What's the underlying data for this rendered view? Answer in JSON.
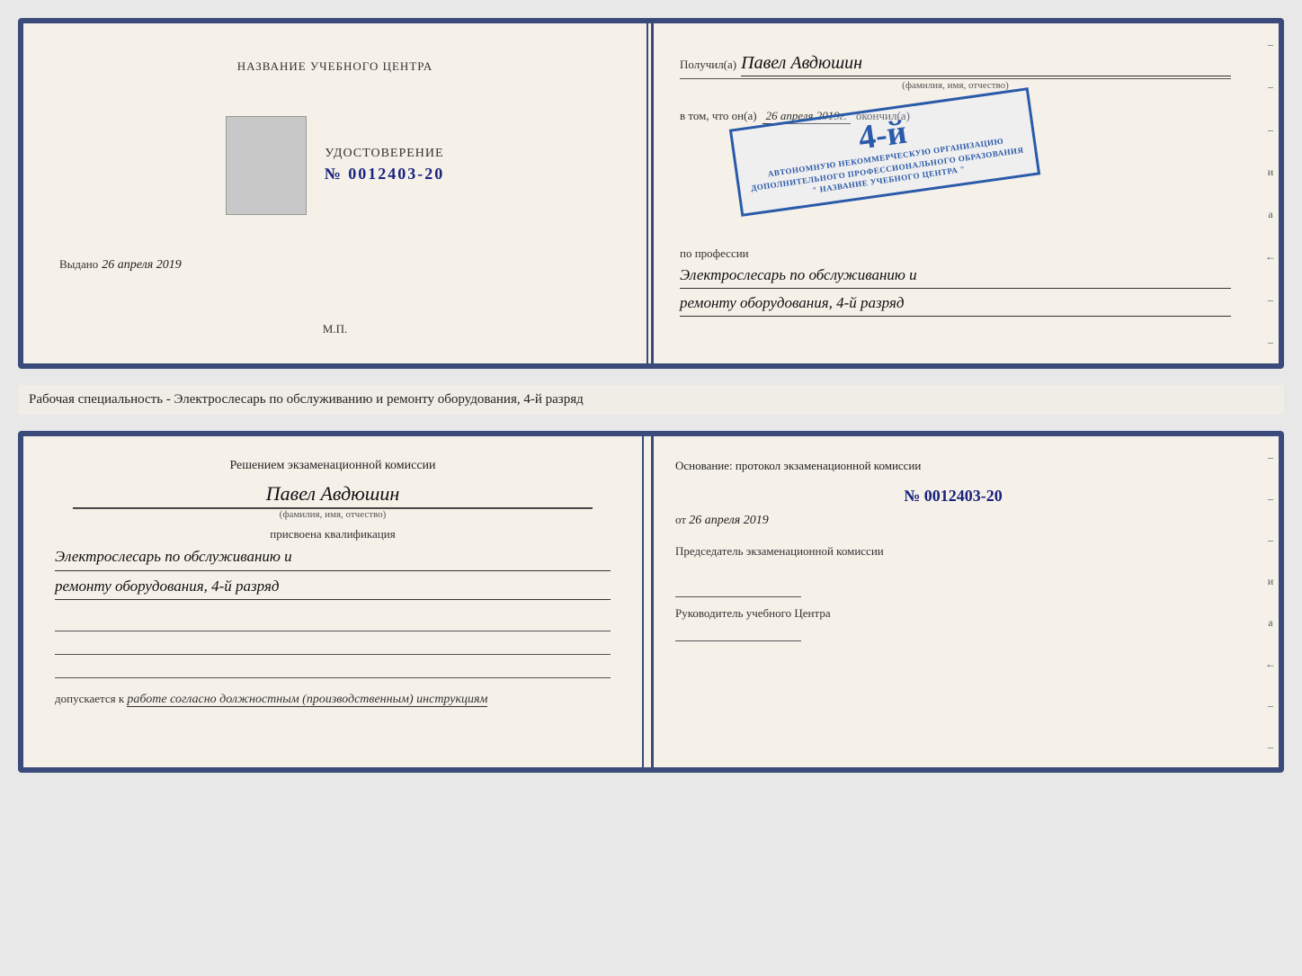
{
  "top_doc": {
    "left": {
      "center_title": "НАЗВАНИЕ УЧЕБНОГО ЦЕНТРА",
      "udost_label": "УДОСТОВЕРЕНИЕ",
      "udost_number": "№ 0012403-20",
      "vydano_label": "Выдано",
      "vydano_date": "26 апреля 2019",
      "mp_label": "М.П."
    },
    "right": {
      "poluchil_label": "Получил(а)",
      "person_name": "Павел Авдюшин",
      "fio_hint": "(фамилия, имя, отчество)",
      "vtom_prefix": "в том, что он(а)",
      "vtom_date": "26 апреля 2019г.",
      "okonchil_label": "окончил(а)",
      "stamp_line1": "4-й",
      "stamp_org1": "АВТОНОМНУЮ НЕКОММЕРЧЕСКУЮ ОРГАНИЗАЦИЮ",
      "stamp_org2": "ДОПОЛНИТЕЛЬНОГО ПРОФЕССИОНАЛЬНОГО ОБРАЗОВАНИЯ",
      "stamp_org3": "\" НАЗВАНИЕ УЧЕБНОГО ЦЕНТРА \"",
      "po_professii_label": "по профессии",
      "profession1": "Электрослесарь по обслуживанию и",
      "profession2": "ремонту оборудования, 4-й разряд"
    }
  },
  "middle": {
    "text": "Рабочая специальность - Электрослесарь по обслуживанию и ремонту оборудования, 4-й разряд"
  },
  "bottom_doc": {
    "left": {
      "decision_title": "Решением экзаменационной комиссии",
      "person_name": "Павел Авдюшин",
      "fio_hint": "(фамилия, имя, отчество)",
      "prisvoena_label": "присвоена квалификация",
      "qualification1": "Электрослесарь по обслуживанию и",
      "qualification2": "ремонту оборудования, 4-й разряд",
      "dopuskaetsya_label": "допускается к",
      "dopusk_text": "работе согласно должностным (производственным) инструкциям"
    },
    "right": {
      "osnovanie_label": "Основание: протокол экзаменационной комиссии",
      "protocol_number": "№ 0012403-20",
      "ot_prefix": "от",
      "ot_date": "26 апреля 2019",
      "predsedatel_label": "Председатель экзаменационной комиссии",
      "rukovoditel_label": "Руководитель учебного Центра"
    }
  },
  "right_edge": {
    "chars": [
      "–",
      "–",
      "и",
      "а",
      "←",
      "–",
      "–",
      "–"
    ]
  }
}
